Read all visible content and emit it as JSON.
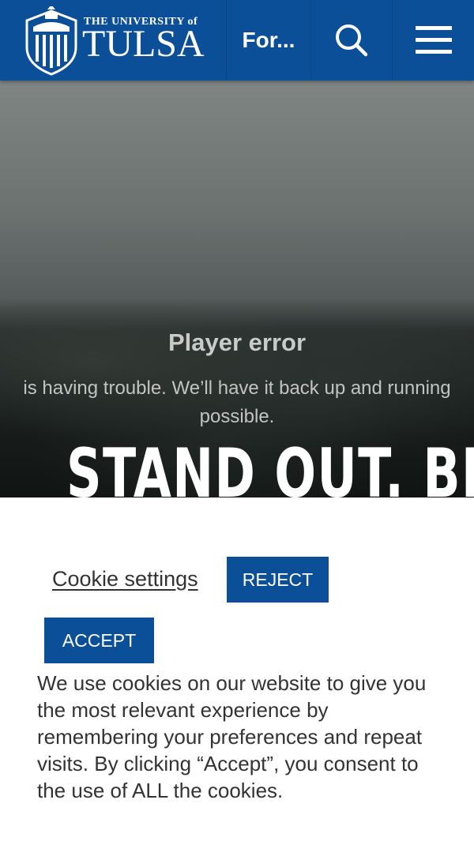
{
  "header": {
    "logo_small": "THE UNIVERSITY of",
    "logo_big": "TULSA",
    "nav_for_label": "For...",
    "search_icon": "search-icon",
    "menu_icon": "hamburger-menu-icon",
    "brand_color": "#0b4f99"
  },
  "hero": {
    "error_title": "Player error",
    "error_message": "is having trouble. We’ll have it back up and running possible.",
    "headline": "STAND OUT. BELONG"
  },
  "cookie": {
    "settings_label": "Cookie settings",
    "reject_label": "REJECT",
    "accept_label": "ACCEPT",
    "message": "We use cookies on our website to give you the most relevant experience by remembering your preferences and repeat visits. By clicking “Accept”, you consent to the use of ALL the cookies."
  }
}
